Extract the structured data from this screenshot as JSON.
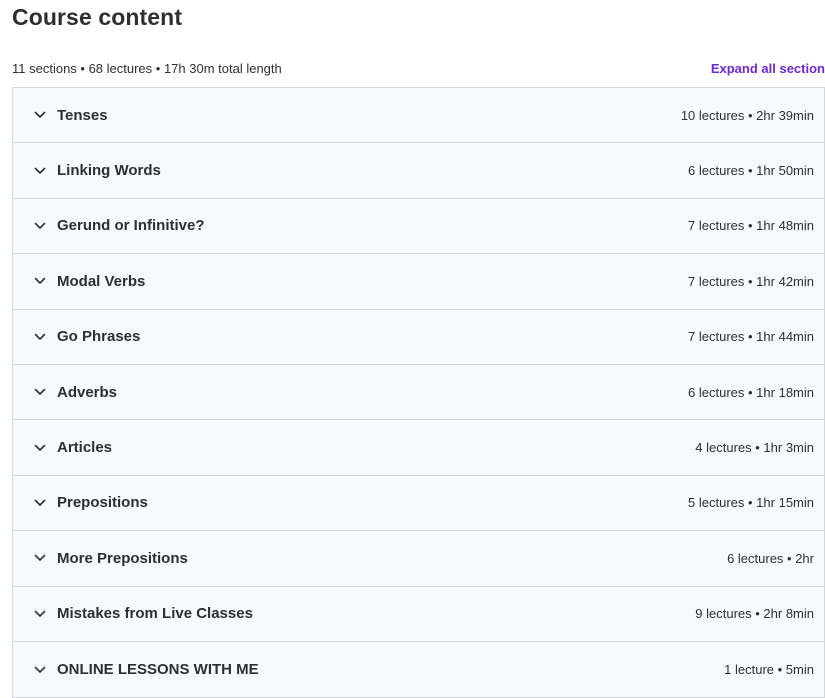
{
  "header": {
    "title": "Course content",
    "summary": "11 sections • 68 lectures • 17h 30m total length",
    "expand_label": "Expand all section"
  },
  "sections": [
    {
      "title": "Tenses",
      "meta": "10 lectures • 2hr 39min",
      "icon": "chevron-down-icon"
    },
    {
      "title": "Linking Words",
      "meta": "6 lectures • 1hr 50min",
      "icon": "chevron-down-icon"
    },
    {
      "title": "Gerund or Infinitive?",
      "meta": "7 lectures • 1hr 48min",
      "icon": "chevron-down-icon"
    },
    {
      "title": "Modal Verbs",
      "meta": "7 lectures • 1hr 42min",
      "icon": "chevron-down-icon"
    },
    {
      "title": "Go Phrases",
      "meta": "7 lectures • 1hr 44min",
      "icon": "chevron-down-icon"
    },
    {
      "title": "Adverbs",
      "meta": "6 lectures • 1hr 18min",
      "icon": "chevron-down-icon"
    },
    {
      "title": "Articles",
      "meta": "4 lectures • 1hr 3min",
      "icon": "chevron-down-icon"
    },
    {
      "title": "Prepositions",
      "meta": "5 lectures • 1hr 15min",
      "icon": "chevron-down-icon"
    },
    {
      "title": "More Prepositions",
      "meta": "6 lectures • 2hr",
      "icon": "chevron-down-icon"
    },
    {
      "title": "Mistakes from Live Classes",
      "meta": "9 lectures • 2hr 8min",
      "icon": "chevron-down-icon"
    },
    {
      "title": "ONLINE LESSONS WITH ME",
      "meta": "1 lecture • 5min",
      "icon": "chevron-down-icon"
    }
  ],
  "colors": {
    "accent": "#6d28d2",
    "text": "#2d2f31",
    "row_background": "#f7f9fa",
    "border": "#d1d7dc"
  }
}
